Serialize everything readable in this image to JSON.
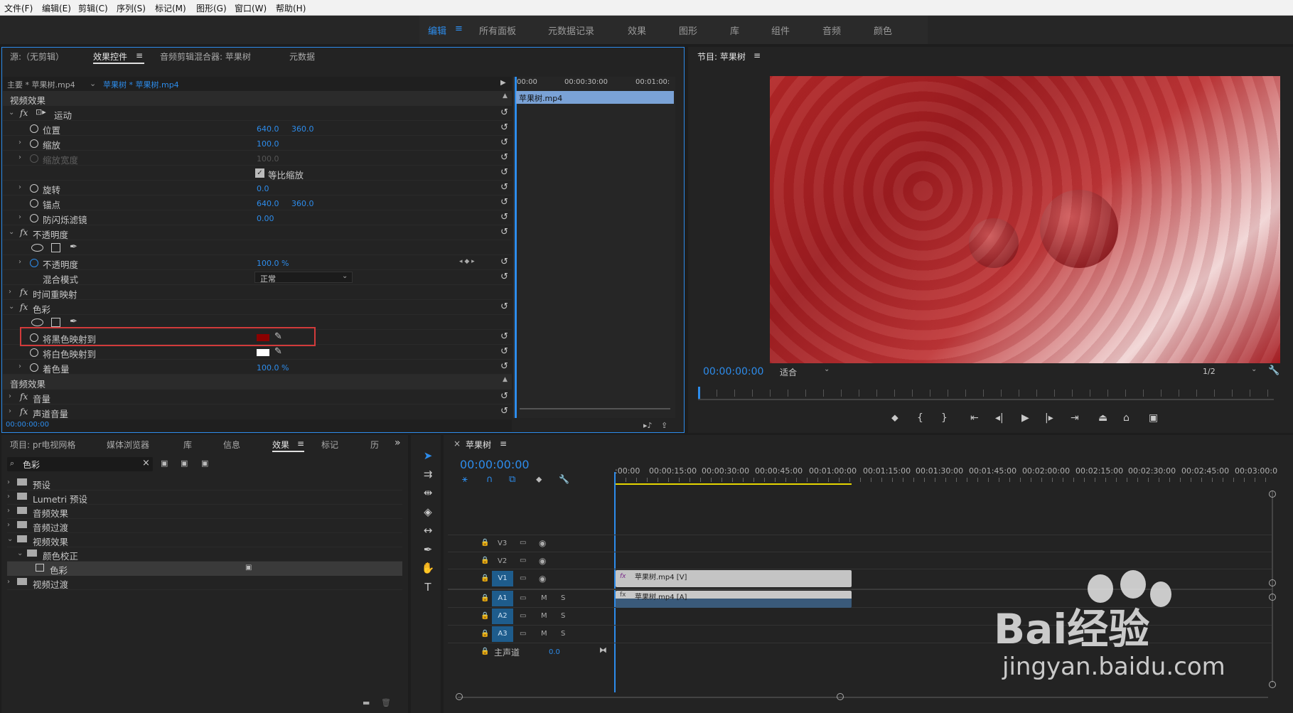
{
  "menu": [
    "文件(F)",
    "编辑(E)",
    "剪辑(C)",
    "序列(S)",
    "标记(M)",
    "图形(G)",
    "窗口(W)",
    "帮助(H)"
  ],
  "workspaces": [
    "编辑",
    "所有面板",
    "元数据记录",
    "效果",
    "图形",
    "库",
    "组件",
    "音频",
    "颜色"
  ],
  "top_panel": {
    "tabs": [
      "源:（无剪辑）",
      "效果控件",
      "音频剪辑混合器: 苹果树",
      "元数据"
    ],
    "master_label": "主要 * 苹果树.mp4",
    "clip_label": "苹果树 * 苹果树.mp4",
    "ruler": [
      "00:00",
      "00:00:30:00",
      "00:01:00:"
    ],
    "clip_block": "苹果树.mp4",
    "timecode": "00:00:00:00",
    "sections": {
      "video": "视频效果",
      "motion": "运动",
      "position": "位置",
      "position_x": "640.0",
      "position_y": "360.0",
      "scale": "缩放",
      "scale_val": "100.0",
      "scale_width": "缩放宽度",
      "scale_width_val": "100.0",
      "uniform": "等比缩放",
      "rotation": "旋转",
      "rotation_val": "0.0",
      "anchor": "锚点",
      "anchor_x": "640.0",
      "anchor_y": "360.0",
      "flicker": "防闪烁滤镜",
      "flicker_val": "0.00",
      "opacity_group": "不透明度",
      "opacity": "不透明度",
      "opacity_val": "100.0 %",
      "blend": "混合模式",
      "blend_val": "正常",
      "time_remap": "时间重映射",
      "tint_group": "色彩",
      "map_black": "将黑色映射到",
      "map_white": "将白色映射到",
      "tint_amount": "着色量",
      "tint_amount_val": "100.0 %",
      "audio": "音频效果",
      "volume": "音量",
      "channel": "声道音量"
    }
  },
  "program": {
    "title": "节目: 苹果树",
    "timecode": "00:00:00:00",
    "fit": "适合",
    "quality": "1/2"
  },
  "project": {
    "tabs": [
      "项目: pr电视网格",
      "媒体浏览器",
      "库",
      "信息",
      "效果",
      "标记",
      "历"
    ],
    "search": "色彩",
    "items": [
      "预设",
      "Lumetri 预设",
      "音频效果",
      "音频过渡",
      "视频效果",
      "颜色校正",
      "色彩",
      "视频过渡"
    ]
  },
  "timeline": {
    "title": "苹果树",
    "timecode": "00:00:00:00",
    "ruler": [
      ":00:00",
      "00:00:15:00",
      "00:00:30:00",
      "00:00:45:00",
      "00:01:00:00",
      "00:01:15:00",
      "00:01:30:00",
      "00:01:45:00",
      "00:02:00:00",
      "00:02:15:00",
      "00:02:30:00",
      "00:02:45:00",
      "00:03:00:0"
    ],
    "tracks": [
      "V3",
      "V2",
      "V1",
      "A1",
      "A2",
      "A3"
    ],
    "master": "主声道",
    "master_val": "0.0",
    "video_clip": "苹果树.mp4 [V]",
    "audio_clip": "苹果树.mp4 [A]",
    "m": "M",
    "s": "S"
  },
  "watermark": {
    "brand": "Bai经验",
    "url": "jingyan.baidu.com"
  },
  "colors": {
    "accent": "#2d8ceb",
    "black_map": "#8b0000",
    "highlight_box": "#d23b3b"
  }
}
